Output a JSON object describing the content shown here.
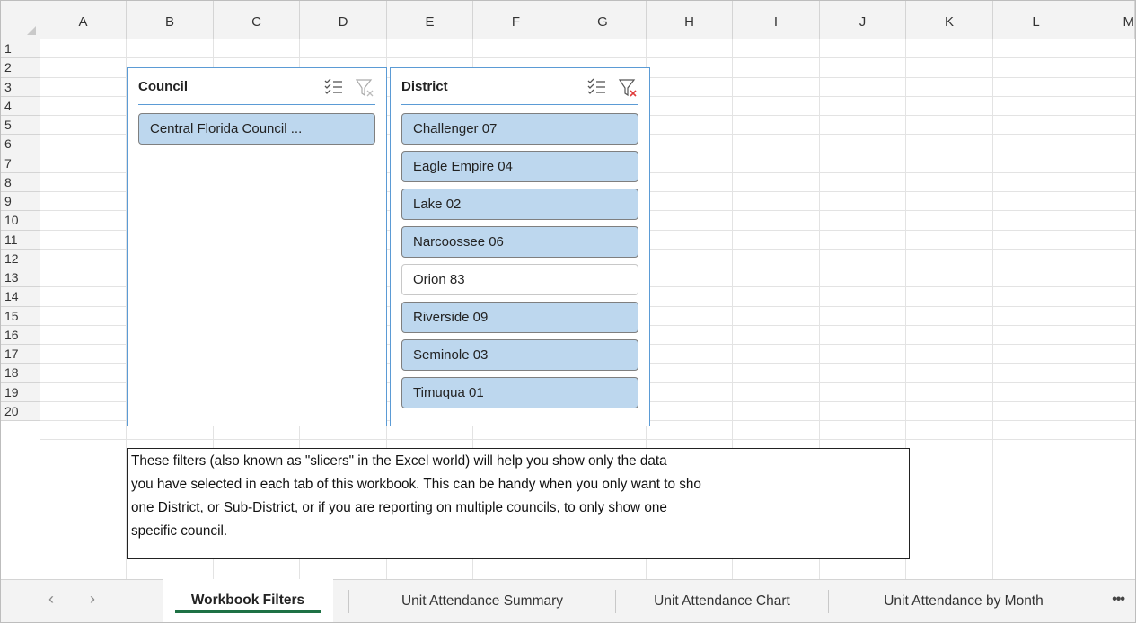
{
  "columns": [
    "A",
    "B",
    "C",
    "D",
    "E",
    "F",
    "G",
    "H",
    "I",
    "J",
    "K",
    "L",
    "M"
  ],
  "rows": [
    "1",
    "2",
    "3",
    "4",
    "5",
    "6",
    "7",
    "8",
    "9",
    "10",
    "11",
    "12",
    "13",
    "14",
    "15",
    "16",
    "17",
    "18",
    "19",
    "20"
  ],
  "council_slicer": {
    "title": "Council",
    "items": [
      {
        "label": "Central Florida Council ...",
        "selected": true
      }
    ],
    "icons": [
      "multi-select-icon",
      "clear-filter-icon"
    ]
  },
  "district_slicer": {
    "title": "District",
    "items": [
      {
        "label": "Challenger 07",
        "selected": true
      },
      {
        "label": "Eagle Empire 04",
        "selected": true
      },
      {
        "label": "Lake 02",
        "selected": true
      },
      {
        "label": "Narcoossee 06",
        "selected": true
      },
      {
        "label": "Orion 83",
        "selected": false
      },
      {
        "label": "Riverside 09",
        "selected": true
      },
      {
        "label": "Seminole 03",
        "selected": true
      },
      {
        "label": "Timuqua 01",
        "selected": true
      }
    ],
    "icons": [
      "multi-select-icon",
      "clear-filter-icon"
    ]
  },
  "textbox": {
    "lines": [
      "These filters (also known as \"slicers\" in the Excel world) will help you show only the data",
      "you have selected in each tab of this workbook. This can be handy when you only want to sho",
      "one District, or Sub-District, or if you are reporting on multiple councils, to only show one",
      "specific council."
    ]
  },
  "tabs": {
    "prev_icon": "‹",
    "next_icon": "›",
    "items": [
      {
        "label": "Workbook Filters",
        "active": true
      },
      {
        "label": "Unit Attendance Summary",
        "active": false
      },
      {
        "label": "Unit Attendance Chart",
        "active": false
      },
      {
        "label": "Unit Attendance by Month",
        "active": false
      }
    ],
    "more_label": "•••"
  },
  "colors": {
    "slicer_border": "#5b9bd5",
    "selected_item": "#bdd7ee",
    "active_tab_underline": "#1e7145",
    "clear_filter_x": "#e03c3c"
  }
}
